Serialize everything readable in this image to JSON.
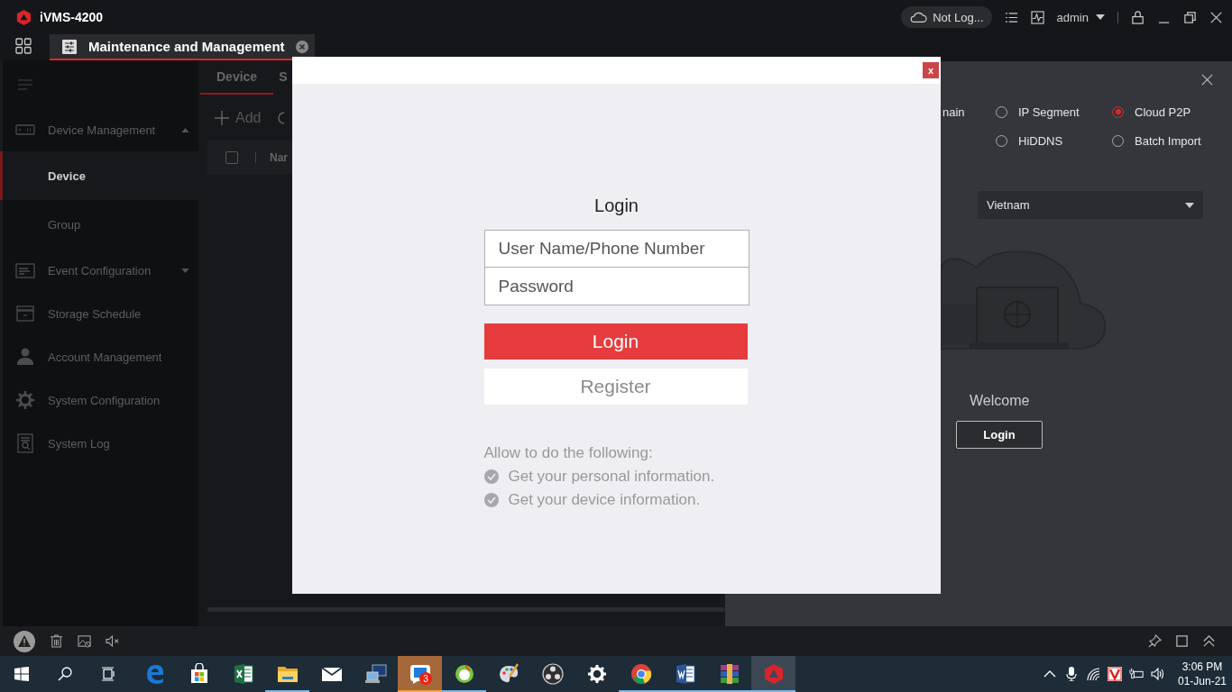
{
  "title_bar": {
    "app_name": "iVMS-4200",
    "cloud_status": "Not Log...",
    "user": "admin"
  },
  "module_tab": {
    "label": "Maintenance and Management",
    "selected": true
  },
  "sidebar": {
    "items": [
      {
        "label": "Device Management",
        "selected": false,
        "expanded": true,
        "children": [
          {
            "label": "Device",
            "selected": true
          },
          {
            "label": "Group",
            "selected": false
          }
        ]
      },
      {
        "label": "Event Configuration",
        "selected": false,
        "expanded": false
      },
      {
        "label": "Storage Schedule",
        "selected": false
      },
      {
        "label": "Account Management",
        "selected": false
      },
      {
        "label": "System Configuration",
        "selected": false
      },
      {
        "label": "System Log",
        "selected": false
      }
    ]
  },
  "content": {
    "tabs": [
      {
        "label": "Device",
        "selected": true
      },
      {
        "label": "S",
        "selected": false
      }
    ],
    "add_button": "Add",
    "table": {
      "select_all_checked": false,
      "columns": [
        "Nar"
      ]
    }
  },
  "add_panel": {
    "modes": [
      {
        "label": "nain",
        "kind": "cut"
      },
      {
        "label": "IP Segment",
        "kind": "radio",
        "selected": false
      },
      {
        "label": "Cloud P2P",
        "kind": "radio",
        "selected": true
      },
      {
        "label": "HiDDNS",
        "kind": "radio",
        "selected": false
      },
      {
        "label": "Batch Import",
        "kind": "radio",
        "selected": false
      }
    ],
    "region": "Vietnam",
    "welcome": "Welcome",
    "login_button": "Login"
  },
  "login_dialog": {
    "close": "x",
    "title": "Login",
    "username_placeholder": "User Name/Phone Number",
    "password_placeholder": "Password",
    "login_button": "Login",
    "register_button": "Register",
    "permissions_title": "Allow to do the following:",
    "permissions": [
      "Get your personal information.",
      "Get your device information."
    ]
  },
  "taskbar": {
    "apps": [
      {
        "kind": "edge",
        "running": false,
        "selected": false
      },
      {
        "kind": "store",
        "running": false,
        "selected": false
      },
      {
        "kind": "excel",
        "running": false,
        "selected": false
      },
      {
        "kind": "explorer",
        "running": true,
        "selected": false
      },
      {
        "kind": "mail",
        "running": false,
        "selected": false
      },
      {
        "kind": "remote",
        "running": false,
        "selected": false
      },
      {
        "kind": "chat",
        "running": true,
        "selected": false,
        "attention": true,
        "badge": "3"
      },
      {
        "kind": "green",
        "running": true,
        "selected": false
      },
      {
        "kind": "paint",
        "running": false,
        "selected": false
      },
      {
        "kind": "obs",
        "running": false,
        "selected": false
      },
      {
        "kind": "settings",
        "running": false,
        "selected": false
      },
      {
        "kind": "chrome",
        "running": true,
        "selected": false
      },
      {
        "kind": "word",
        "running": true,
        "selected": false
      },
      {
        "kind": "archive",
        "running": true,
        "selected": false
      },
      {
        "kind": "ivms",
        "running": true,
        "selected": true
      }
    ],
    "time": "3:06 PM",
    "date": "01-Jun-21"
  }
}
